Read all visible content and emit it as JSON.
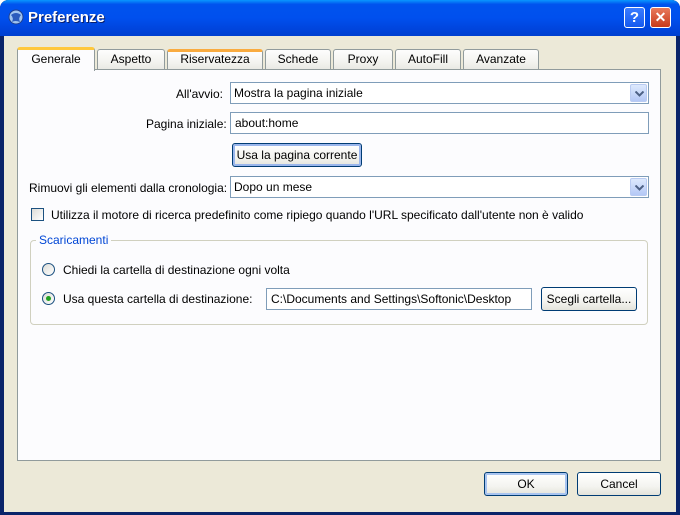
{
  "window": {
    "title": "Preferenze",
    "help_glyph": "?",
    "close_glyph": "✕",
    "app_icon": "globe-icon"
  },
  "tabs": [
    {
      "label": "Generale",
      "active": true
    },
    {
      "label": "Aspetto"
    },
    {
      "label": "Riservatezza"
    },
    {
      "label": "Schede"
    },
    {
      "label": "Proxy"
    },
    {
      "label": "AutoFill"
    },
    {
      "label": "Avanzate"
    }
  ],
  "general": {
    "startup_label": "All'avvio:",
    "startup_value": "Mostra la pagina iniziale",
    "homepage_label": "Pagina iniziale:",
    "homepage_value": "about:home",
    "use_current_page": "Usa la pagina corrente",
    "history_label": "Rimuovi gli elementi dalla cronologia:",
    "history_value": "Dopo un mese",
    "fallback_search_label": "Utilizza il motore di ricerca predefinito come ripiego quando l'URL specificato dall'utente non è valido",
    "fallback_search_checked": false
  },
  "downloads": {
    "group_title": "Scaricamenti",
    "ask_folder_label": "Chiedi la cartella di destinazione ogni volta",
    "use_folder_label": "Usa questa cartella di destinazione:",
    "folder_path": "C:\\Documents and Settings\\Softonic\\Desktop",
    "choose_folder": "Scegli cartella...",
    "selected": "use_folder"
  },
  "footer": {
    "ok_label": "OK",
    "cancel_label": "Cancel"
  },
  "colors": {
    "titlebar": "#0053ee",
    "dialog_bg": "#ece9d8",
    "active_tab_accent": "#ffc83c",
    "group_title": "#0046d5"
  }
}
